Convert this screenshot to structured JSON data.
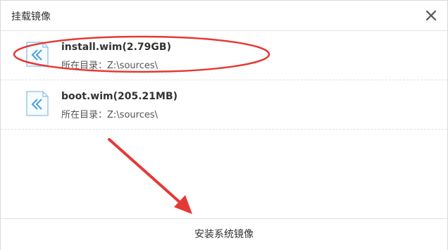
{
  "dialog": {
    "title": "挂载镜像",
    "close_icon": "close-icon"
  },
  "images": [
    {
      "name": "install.wim(2.79GB)",
      "dir_label": "所在目录：",
      "dir_value": "Z:\\sources\\",
      "icon": "wim-file-icon",
      "highlighted": true
    },
    {
      "name": "boot.wim(205.21MB)",
      "dir_label": "所在目录：",
      "dir_value": "Z:\\sources\\",
      "icon": "wim-file-icon",
      "highlighted": false
    }
  ],
  "footer": {
    "install_label": "安装系统镜像"
  },
  "colors": {
    "annotation": "#e53935",
    "icon_accent": "#4a9fd8"
  }
}
